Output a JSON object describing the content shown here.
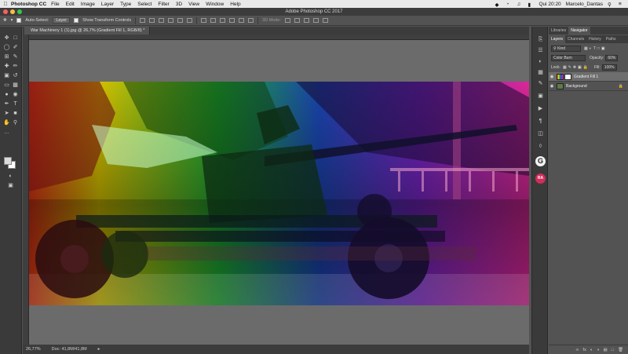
{
  "menubar": {
    "app_name": "Photoshop CC",
    "items": [
      "File",
      "Edit",
      "Image",
      "Layer",
      "Type",
      "Select",
      "Filter",
      "3D",
      "View",
      "Window",
      "Help"
    ],
    "clock": "Qui 20:20",
    "user": "Marcelo_Dantas"
  },
  "window": {
    "title": "Adobe Photoshop CC 2017"
  },
  "options": {
    "auto_select_label": "Auto-Select:",
    "auto_select_target": "Layer",
    "show_transform_label": "Show Transform Controls",
    "mode_3d_label": "3D Mode:"
  },
  "document": {
    "tab_title": "War Machinery 1 (1).jpg @ 26,7% (Gradient Fill 1, RGB/8) *",
    "zoom": "26,77%",
    "doc_size": "Doc: 41,8M/41,8M"
  },
  "panels": {
    "top_tabs": [
      "Libraries",
      "Navigator"
    ],
    "tabs": [
      "Layers",
      "Channels",
      "History",
      "Paths"
    ],
    "filter_kind": "Kind",
    "blend_mode": "Color Burn",
    "opacity_label": "Opacity:",
    "opacity_value": "60%",
    "lock_label": "Lock:",
    "fill_label": "Fill:",
    "fill_value": "100%",
    "layers": [
      {
        "name": "Gradient Fill 1"
      },
      {
        "name": "Background"
      }
    ]
  },
  "icons": {
    "plugin_g": "G",
    "plugin_ra": "RA"
  },
  "colors": {
    "accent_red": "#d12d5a",
    "panel_bg": "#535353",
    "gradient": [
      "#ff3b1a",
      "#ffe000",
      "#22c23c",
      "#1e6fd8",
      "#7b2ff0",
      "#ff2fb0"
    ]
  }
}
